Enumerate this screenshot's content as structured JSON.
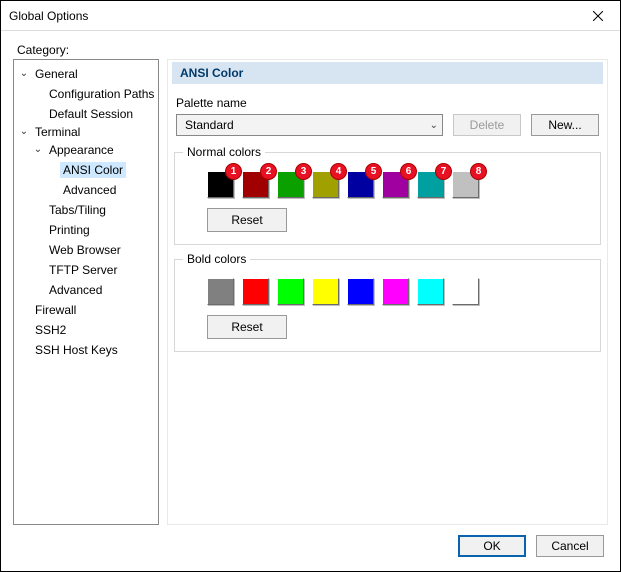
{
  "window": {
    "title": "Global Options"
  },
  "labels": {
    "category": "Category:",
    "palette_name": "Palette name",
    "normal_colors": "Normal colors",
    "bold_colors": "Bold colors"
  },
  "panel": {
    "title": "ANSI Color"
  },
  "palette": {
    "selected": "Standard",
    "delete_label": "Delete",
    "new_label": "New...",
    "reset_label": "Reset"
  },
  "tree": {
    "general": "General",
    "configuration_paths": "Configuration Paths",
    "default_session": "Default Session",
    "terminal": "Terminal",
    "appearance": "Appearance",
    "ansi_color": "ANSI Color",
    "advanced": "Advanced",
    "tabs_tiling": "Tabs/Tiling",
    "printing": "Printing",
    "web_browser": "Web Browser",
    "tftp_server": "TFTP Server",
    "advanced2": "Advanced",
    "firewall": "Firewall",
    "ssh2": "SSH2",
    "ssh_host_keys": "SSH Host Keys"
  },
  "normal_colors": [
    {
      "hex": "#000000",
      "badge": "1"
    },
    {
      "hex": "#a00000",
      "badge": "2"
    },
    {
      "hex": "#0aa000",
      "badge": "3"
    },
    {
      "hex": "#a0a000",
      "badge": "4"
    },
    {
      "hex": "#0000a0",
      "badge": "5"
    },
    {
      "hex": "#a000a0",
      "badge": "6"
    },
    {
      "hex": "#00a0a0",
      "badge": "7"
    },
    {
      "hex": "#c0c0c0",
      "badge": "8"
    }
  ],
  "bold_colors": [
    {
      "hex": "#808080"
    },
    {
      "hex": "#ff0000"
    },
    {
      "hex": "#00ff00"
    },
    {
      "hex": "#ffff00"
    },
    {
      "hex": "#0000ff"
    },
    {
      "hex": "#ff00ff"
    },
    {
      "hex": "#00ffff"
    },
    {
      "hex": "#ffffff"
    }
  ],
  "footer": {
    "ok": "OK",
    "cancel": "Cancel"
  }
}
